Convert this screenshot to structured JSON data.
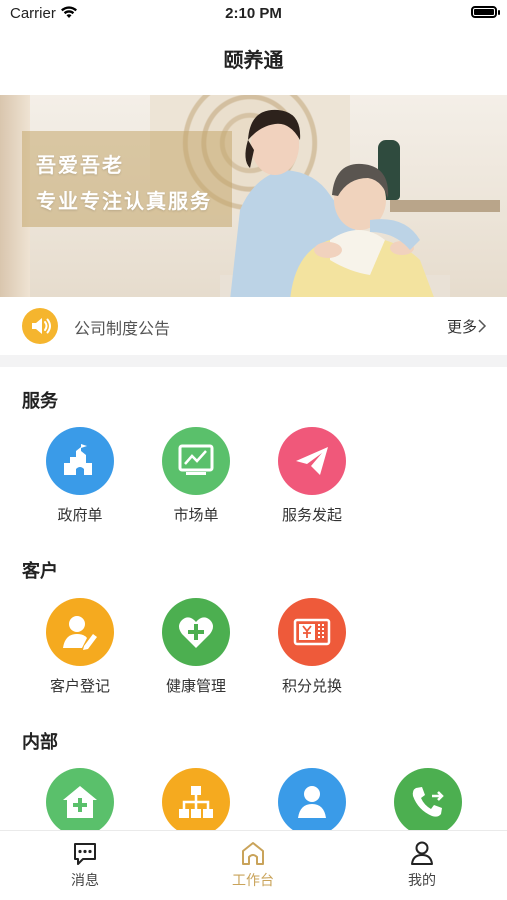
{
  "status_bar": {
    "carrier": "Carrier",
    "time": "2:10 PM"
  },
  "nav": {
    "title": "颐养通"
  },
  "banner": {
    "line1": "吾爱吾老",
    "line2": "专业专注认真服务"
  },
  "notice": {
    "label": "公司制度公告",
    "more": "更多"
  },
  "sections": [
    {
      "title": "服务",
      "items": [
        {
          "label": "政府单",
          "icon": "government-icon",
          "color": "#3a9be8"
        },
        {
          "label": "市场单",
          "icon": "market-chart-icon",
          "color": "#5ac06b"
        },
        {
          "label": "服务发起",
          "icon": "paper-plane-icon",
          "color": "#f0587a"
        }
      ]
    },
    {
      "title": "客户",
      "items": [
        {
          "label": "客户登记",
          "icon": "user-edit-icon",
          "color": "#f5aa1f"
        },
        {
          "label": "健康管理",
          "icon": "heart-plus-icon",
          "color": "#4caf50"
        },
        {
          "label": "积分兑换",
          "icon": "points-ticket-icon",
          "color": "#ee5a3a"
        }
      ]
    },
    {
      "title": "内部",
      "items": [
        {
          "label": "",
          "icon": "home-plus-icon",
          "color": "#5ac06b"
        },
        {
          "label": "",
          "icon": "org-chart-icon",
          "color": "#f5aa1f"
        },
        {
          "label": "",
          "icon": "person-icon",
          "color": "#3a9be8"
        },
        {
          "label": "",
          "icon": "phone-forward-icon",
          "color": "#4caf50"
        }
      ]
    }
  ],
  "tabs": [
    {
      "label": "消息",
      "icon": "message-icon",
      "active": false
    },
    {
      "label": "工作台",
      "icon": "workbench-home-icon",
      "active": true
    },
    {
      "label": "我的",
      "icon": "profile-icon",
      "active": false
    }
  ],
  "colors": {
    "accent": "#c9a35a",
    "notice_icon": "#f5b52e"
  }
}
